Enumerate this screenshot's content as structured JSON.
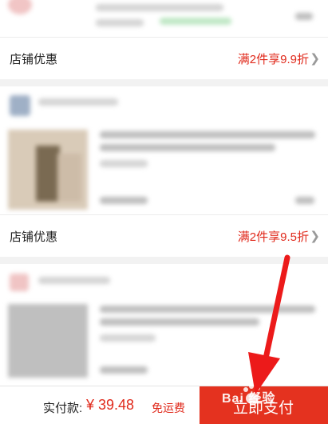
{
  "shops": [
    {
      "promo_label": "店铺优惠",
      "promo_value": "满2件享9.9折"
    },
    {
      "promo_label": "店铺优惠",
      "promo_value": "满2件享9.5折"
    }
  ],
  "footer": {
    "pay_label": "实付款:",
    "amount": "¥ 39.48",
    "shipping": "免运费",
    "submit_label": "立即支付"
  },
  "watermark": "Bai 经验",
  "colors": {
    "accent": "#e0291b",
    "button": "#e4321f",
    "arrow": "#ec1a1a"
  }
}
